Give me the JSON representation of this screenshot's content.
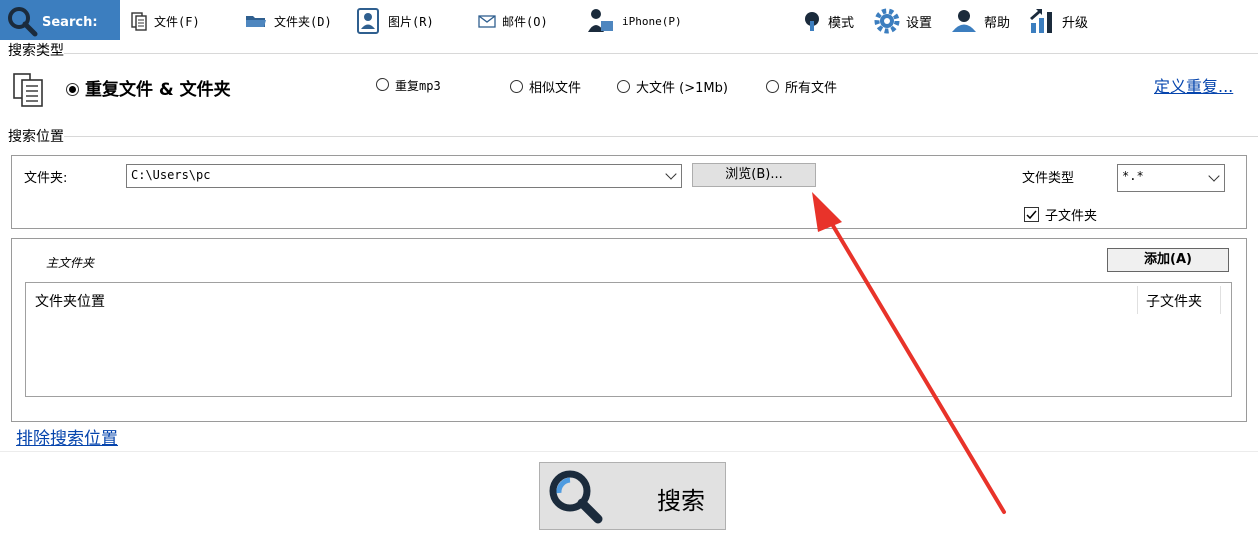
{
  "toolbar": {
    "search_tab": "Search:",
    "items": [
      {
        "label": "文件(F)"
      },
      {
        "label": "文件夹(D)"
      },
      {
        "label": "图片(R)"
      },
      {
        "label": "邮件(O)"
      },
      {
        "label": "iPhone(P)"
      },
      {
        "label": "模式"
      },
      {
        "label": "设置"
      },
      {
        "label": "帮助"
      },
      {
        "label": "升级"
      }
    ]
  },
  "search_type": {
    "title": "搜索类型",
    "options": [
      {
        "label": "重复文件 & 文件夹",
        "selected": true
      },
      {
        "label": "重复mp3",
        "selected": false
      },
      {
        "label": "相似文件",
        "selected": false
      },
      {
        "label": "大文件 (>1Mb)",
        "selected": false
      },
      {
        "label": "所有文件",
        "selected": false
      }
    ],
    "define_link": "定义重复..."
  },
  "search_location": {
    "title": "搜索位置",
    "folder_label": "文件夹:",
    "folder_value": "C:\\Users\\pc",
    "browse_button": "浏览(B)...",
    "file_type_label": "文件类型",
    "file_type_value": "*.*",
    "subfolder_label": "子文件夹",
    "subfolder_checked": true
  },
  "main_folders": {
    "title": "主文件夹",
    "add_button": "添加(A)",
    "columns": [
      "文件夹位置",
      "子文件夹"
    ]
  },
  "exclude_link": "排除搜索位置",
  "search_button": "搜索",
  "colors": {
    "accent": "#3c7ebf",
    "arrow": "#e8332a"
  }
}
